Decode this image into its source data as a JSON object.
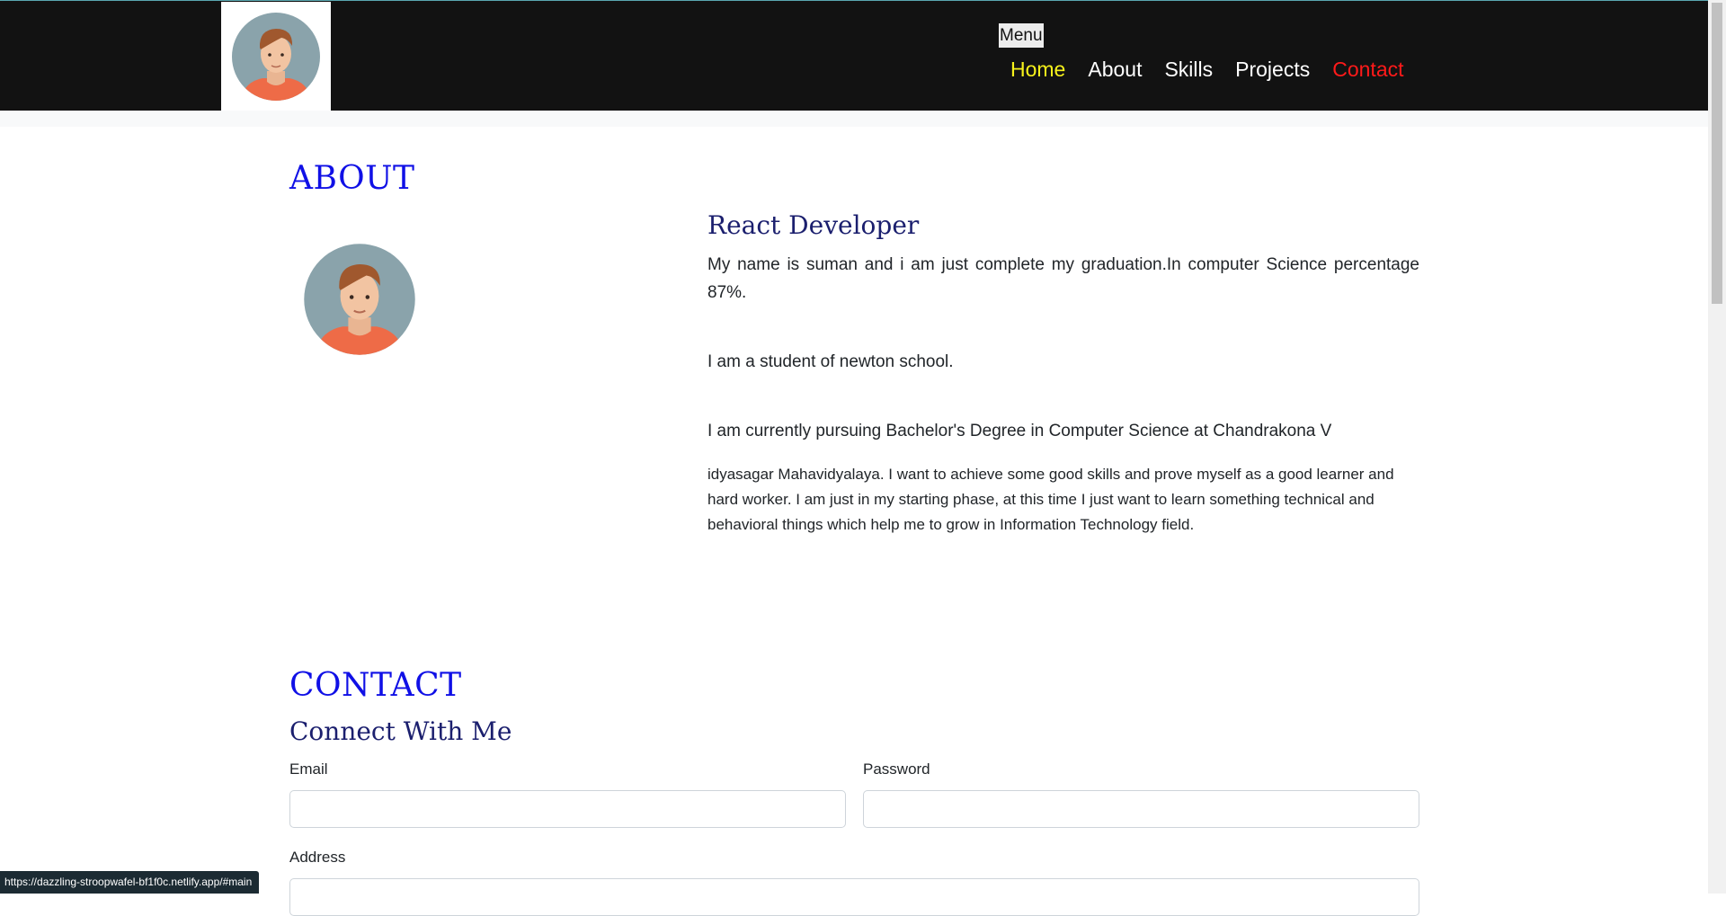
{
  "nav": {
    "menu_label": "Menu",
    "items": [
      {
        "label": "Home"
      },
      {
        "label": "About"
      },
      {
        "label": "Skills"
      },
      {
        "label": "Projects"
      },
      {
        "label": "Contact"
      }
    ]
  },
  "about": {
    "heading": "ABOUT",
    "role": "React Developer",
    "paragraph1": "My name is suman and i am just complete my graduation.In computer Science percentage 87%.",
    "paragraph2": "I am a student of newton school.",
    "paragraph3": "I am currently pursuing Bachelor's Degree in Computer Science at Chandrakona V",
    "paragraph4": "idyasagar Mahavidyalaya. I want to achieve some good skills and prove myself as a good learner and hard worker. I am just in my starting phase, at this time I just want to learn something technical and behavioral things which help me to grow in Information Technology field."
  },
  "contact": {
    "heading": "CONTACT",
    "subheading": "Connect With Me",
    "email_label": "Email",
    "password_label": "Password",
    "address_label": "Address"
  },
  "status_url": "https://dazzling-stroopwafel-bf1f0c.netlify.app/#main",
  "colors": {
    "nav_bg": "#121212",
    "home_link": "#f7f21b",
    "contact_link": "#ff1a1a",
    "section_heading": "#1010e6",
    "subheading": "#1b1f6e"
  },
  "icons": {
    "logo": "avatar-icon",
    "about_photo": "avatar-icon"
  }
}
